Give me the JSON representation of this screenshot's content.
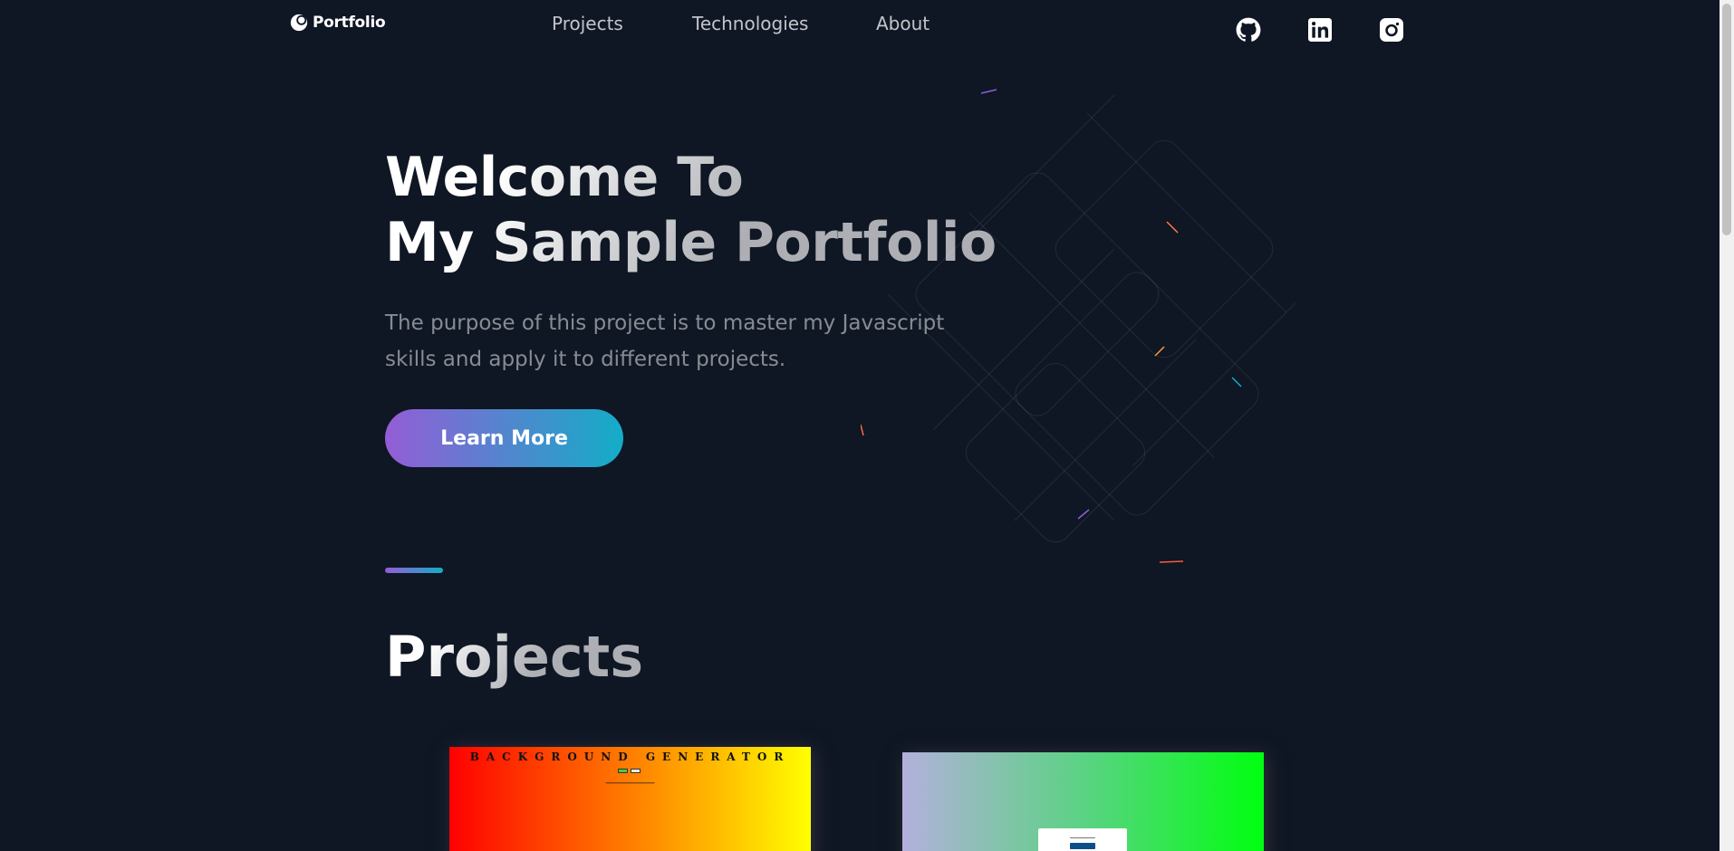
{
  "header": {
    "logo_text": "Portfolio",
    "nav": [
      {
        "label": "Projects"
      },
      {
        "label": "Technologies"
      },
      {
        "label": "About"
      }
    ],
    "social": [
      "github-icon",
      "linkedin-icon",
      "instagram-icon"
    ]
  },
  "hero": {
    "title_line1": "Welcome To",
    "title_line2": "My Sample Portfolio",
    "text": "The purpose of this project is to master my Javascript skills and apply it to different projects.",
    "button_label": "Learn More"
  },
  "projects_section": {
    "title": "Projects",
    "cards": [
      {
        "title": "BACKGROUND GENERATOR"
      }
    ]
  },
  "colors": {
    "background": "#0f1624",
    "gradient_start": "#945dd6",
    "gradient_end": "#13adc7"
  }
}
